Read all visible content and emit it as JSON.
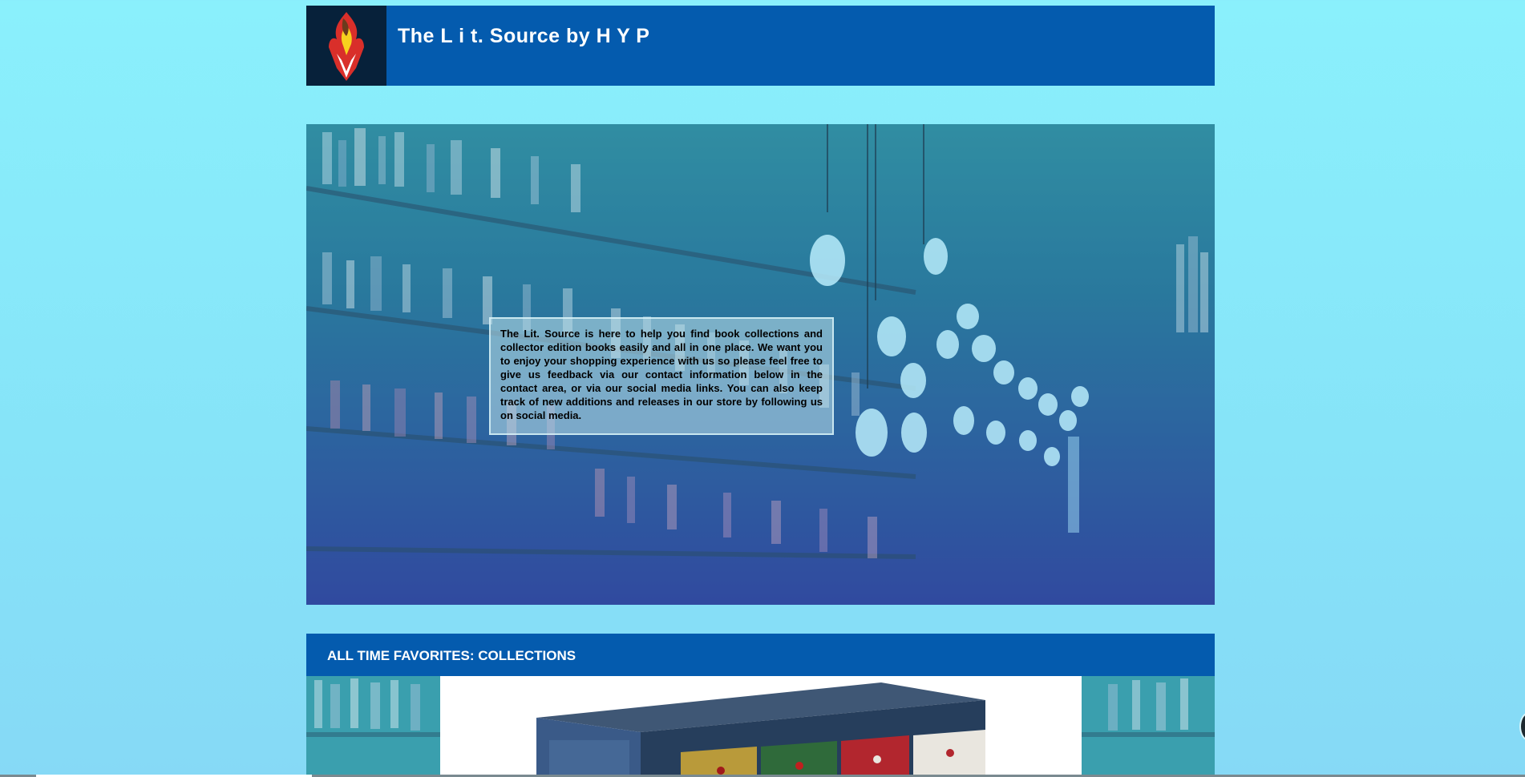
{
  "header": {
    "title": "The L i t. Source by H Y P",
    "logo": "flame-shield-logo"
  },
  "hero": {
    "intro": "The Lit. Source is here to help you find book collections and collector edition books easily and all in one place. We want you to enjoy your shopping experience with us so please feel free to give us feedback via our contact information below in the contact area, or via our social media links. You can also keep track of new additions and releases in our store by following us on social media."
  },
  "collections": {
    "title": "ALL TIME FAVORITES: COLLECTIONS"
  },
  "colors": {
    "page_background": "#8af0fc",
    "header_bar": "#045bae",
    "logo_background": "#07213a",
    "section_bar": "#045bae"
  }
}
